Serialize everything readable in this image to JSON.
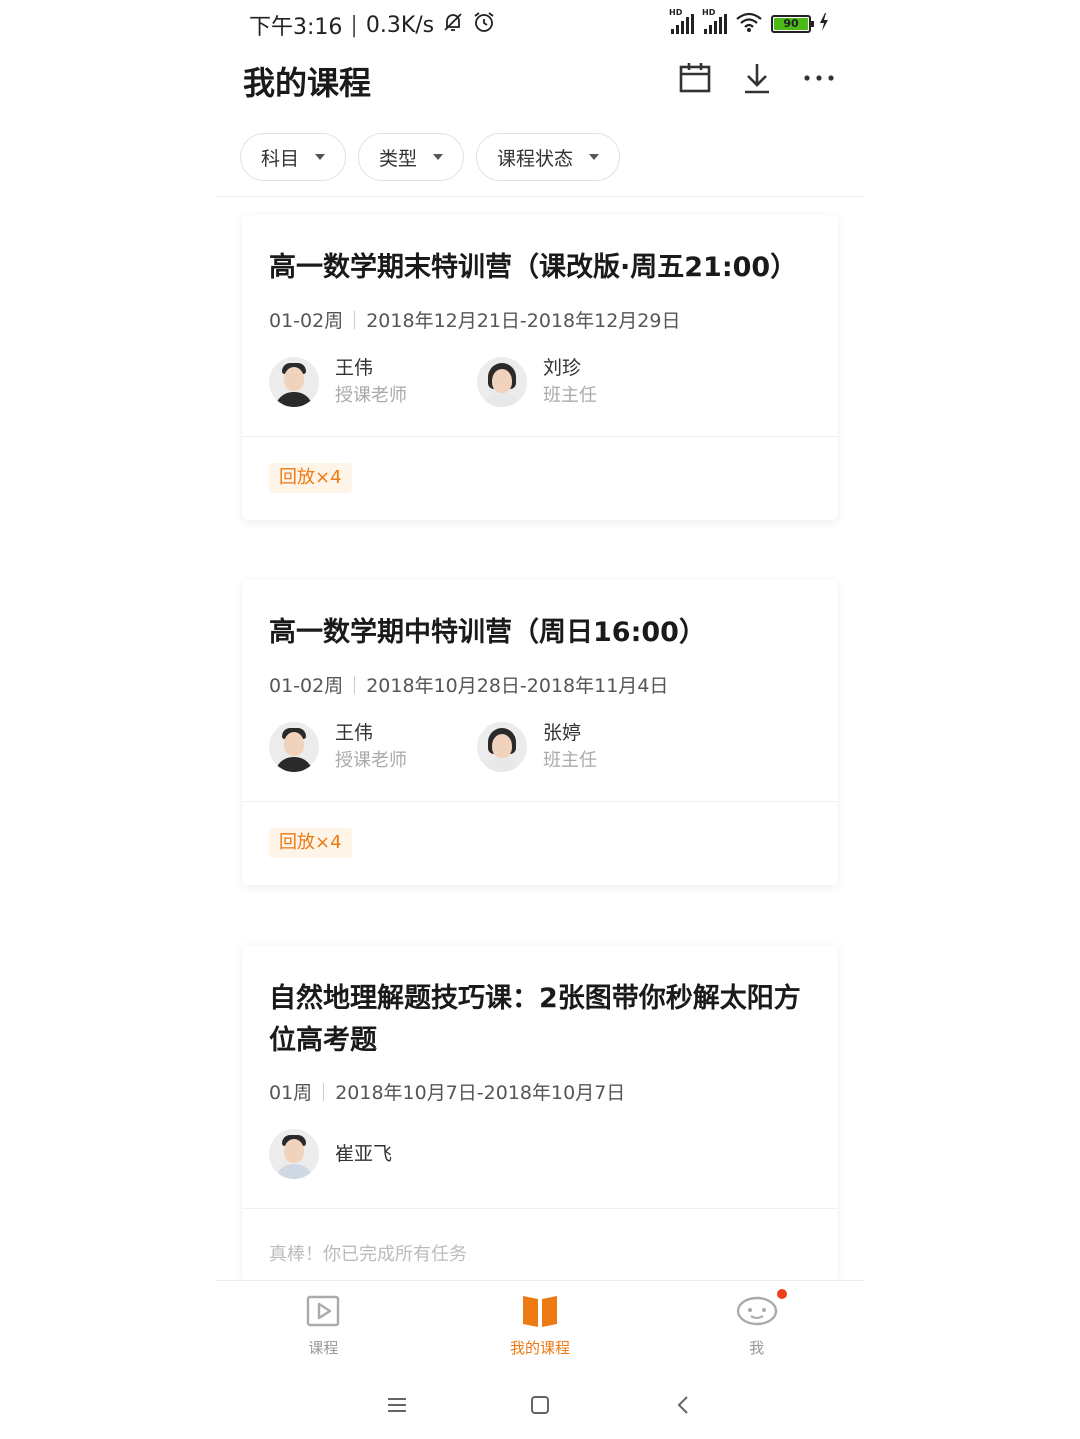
{
  "status_bar": {
    "time": "下午3:16",
    "network_speed": "0.3K/s",
    "battery_level": "90",
    "network_type": "HD",
    "icons": [
      "mute-bell-icon",
      "alarm-icon",
      "signal-icon",
      "signal-icon",
      "wifi-icon",
      "battery-icon",
      "charging-icon"
    ]
  },
  "header": {
    "title": "我的课程",
    "icons": [
      "calendar-icon",
      "download-icon",
      "more-icon"
    ]
  },
  "filters": [
    {
      "label": "科目"
    },
    {
      "label": "类型"
    },
    {
      "label": "课程状态"
    }
  ],
  "courses": [
    {
      "title": "高一数学期末特训营（课改版·周五21:00）",
      "weeks": "01-02周",
      "dates": "2018年12月21日-2018年12月29日",
      "teachers": [
        {
          "name": "王伟",
          "role": "授课老师"
        },
        {
          "name": "刘珍",
          "role": "班主任"
        }
      ],
      "badge": "回放×4"
    },
    {
      "title": "高一数学期中特训营（周日16:00）",
      "weeks": "01-02周",
      "dates": "2018年10月28日-2018年11月4日",
      "teachers": [
        {
          "name": "王伟",
          "role": "授课老师"
        },
        {
          "name": "张婷",
          "role": "班主任"
        }
      ],
      "badge": "回放×4"
    },
    {
      "title": "自然地理解题技巧课：2张图带你秒解太阳方位高考题",
      "weeks": "01周",
      "dates": "2018年10月7日-2018年10月7日",
      "teachers": [
        {
          "name": "崔亚飞"
        }
      ],
      "footer_text": "真棒！你已完成所有任务"
    }
  ],
  "bottom_nav": [
    {
      "label": "课程",
      "icon": "play-course-icon"
    },
    {
      "label": "我的课程",
      "icon": "book-icon",
      "active": true
    },
    {
      "label": "我",
      "icon": "profile-icon"
    }
  ],
  "colors": {
    "accent": "#ee7a13",
    "badge_bg": "#fff4e8",
    "notification_dot": "#f0401b"
  }
}
